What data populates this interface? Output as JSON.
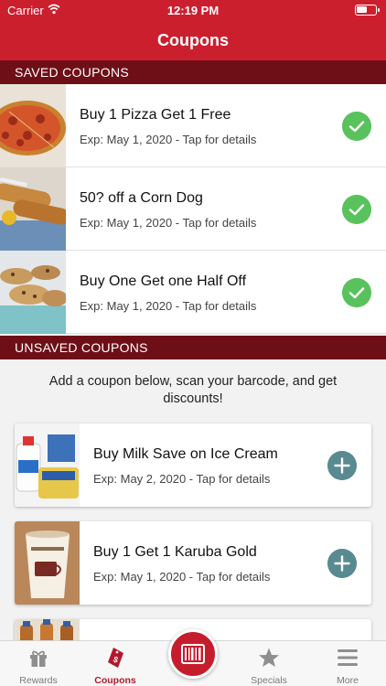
{
  "status_bar": {
    "carrier": "Carrier",
    "time": "12:19 PM"
  },
  "nav": {
    "title": "Coupons"
  },
  "saved_section": {
    "header": "SAVED COUPONS",
    "items": [
      {
        "title": "Buy 1 Pizza Get 1 Free",
        "subtitle": "Exp: May 1, 2020 - Tap for details",
        "image": "pizza",
        "status_icon": "check-icon"
      },
      {
        "title": "50? off a Corn Dog",
        "subtitle": "Exp: May 1, 2020 - Tap for details",
        "image": "corn-dog",
        "status_icon": "check-icon"
      },
      {
        "title": "Buy One Get one Half Off",
        "subtitle": "Exp: May 1, 2020 - Tap for details",
        "image": "cookies",
        "status_icon": "check-icon"
      }
    ]
  },
  "unsaved_section": {
    "header": "UNSAVED COUPONS",
    "helper_text": "Add a coupon below, scan your barcode, and get discounts!",
    "items": [
      {
        "title": "Buy Milk Save on Ice Cream",
        "subtitle": "Exp: May 2, 2020 - Tap for details",
        "image": "milk-ice-cream",
        "action_icon": "plus-icon"
      },
      {
        "title": "Buy 1 Get 1 Karuba Gold",
        "subtitle": "Exp: May 1, 2020 - Tap for details",
        "image": "karuba-cup",
        "action_icon": "plus-icon"
      },
      {
        "title": "",
        "subtitle": "",
        "image": "bottles",
        "action_icon": ""
      }
    ]
  },
  "tab_bar": {
    "items": [
      {
        "label": "Rewards",
        "icon": "gift-icon",
        "active": false
      },
      {
        "label": "Coupons",
        "icon": "coupon-tag-icon",
        "active": true
      },
      {
        "label": "",
        "icon": "barcode-icon",
        "active": false
      },
      {
        "label": "Specials",
        "icon": "star-icon",
        "active": false
      },
      {
        "label": "More",
        "icon": "menu-icon",
        "active": false
      }
    ]
  },
  "colors": {
    "brand_red": "#cc1f2e",
    "section_header": "#6e0f17",
    "check_green": "#59c25c",
    "plus_teal": "#5a8a91",
    "active_tab": "#b3182a"
  }
}
